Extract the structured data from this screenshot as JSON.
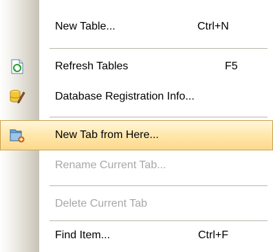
{
  "menu": {
    "items": [
      {
        "label": "New Table...",
        "shortcut": "Ctrl+N",
        "icon": "none",
        "enabled": true
      },
      {
        "label": "Refresh Tables",
        "shortcut": "F5",
        "icon": "refresh-icon",
        "enabled": true
      },
      {
        "label": "Database Registration Info...",
        "shortcut": "",
        "icon": "database-edit-icon",
        "enabled": true
      },
      {
        "label": "New Tab from Here...",
        "shortcut": "",
        "icon": "new-tab-icon",
        "enabled": true,
        "highlighted": true
      },
      {
        "label": "Rename Current Tab...",
        "shortcut": "",
        "icon": "none",
        "enabled": false
      },
      {
        "label": "Delete Current Tab",
        "shortcut": "",
        "icon": "none",
        "enabled": false
      },
      {
        "label": "Find Item...",
        "shortcut": "Ctrl+F",
        "icon": "none",
        "enabled": true
      }
    ]
  },
  "colors": {
    "highlight_fill": "#ffe6a8",
    "highlight_border": "#c9a24a",
    "disabled_text": "#a7a7a7"
  }
}
